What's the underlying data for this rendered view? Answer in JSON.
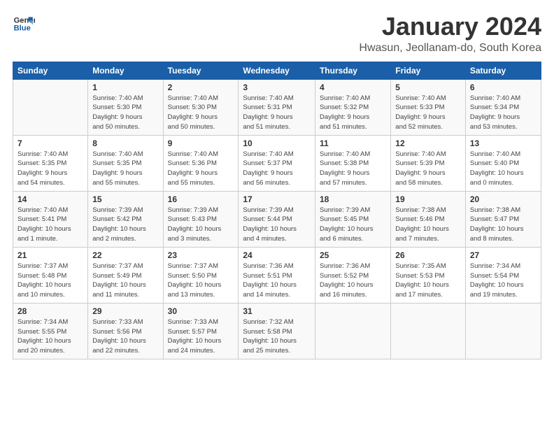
{
  "logo": {
    "line1": "General",
    "line2": "Blue"
  },
  "title": "January 2024",
  "subtitle": "Hwasun, Jeollanam-do, South Korea",
  "columns": [
    "Sunday",
    "Monday",
    "Tuesday",
    "Wednesday",
    "Thursday",
    "Friday",
    "Saturday"
  ],
  "weeks": [
    [
      {
        "day": "",
        "info": ""
      },
      {
        "day": "1",
        "info": "Sunrise: 7:40 AM\nSunset: 5:30 PM\nDaylight: 9 hours\nand 50 minutes."
      },
      {
        "day": "2",
        "info": "Sunrise: 7:40 AM\nSunset: 5:30 PM\nDaylight: 9 hours\nand 50 minutes."
      },
      {
        "day": "3",
        "info": "Sunrise: 7:40 AM\nSunset: 5:31 PM\nDaylight: 9 hours\nand 51 minutes."
      },
      {
        "day": "4",
        "info": "Sunrise: 7:40 AM\nSunset: 5:32 PM\nDaylight: 9 hours\nand 51 minutes."
      },
      {
        "day": "5",
        "info": "Sunrise: 7:40 AM\nSunset: 5:33 PM\nDaylight: 9 hours\nand 52 minutes."
      },
      {
        "day": "6",
        "info": "Sunrise: 7:40 AM\nSunset: 5:34 PM\nDaylight: 9 hours\nand 53 minutes."
      }
    ],
    [
      {
        "day": "7",
        "info": "Sunrise: 7:40 AM\nSunset: 5:35 PM\nDaylight: 9 hours\nand 54 minutes."
      },
      {
        "day": "8",
        "info": "Sunrise: 7:40 AM\nSunset: 5:35 PM\nDaylight: 9 hours\nand 55 minutes."
      },
      {
        "day": "9",
        "info": "Sunrise: 7:40 AM\nSunset: 5:36 PM\nDaylight: 9 hours\nand 55 minutes."
      },
      {
        "day": "10",
        "info": "Sunrise: 7:40 AM\nSunset: 5:37 PM\nDaylight: 9 hours\nand 56 minutes."
      },
      {
        "day": "11",
        "info": "Sunrise: 7:40 AM\nSunset: 5:38 PM\nDaylight: 9 hours\nand 57 minutes."
      },
      {
        "day": "12",
        "info": "Sunrise: 7:40 AM\nSunset: 5:39 PM\nDaylight: 9 hours\nand 58 minutes."
      },
      {
        "day": "13",
        "info": "Sunrise: 7:40 AM\nSunset: 5:40 PM\nDaylight: 10 hours\nand 0 minutes."
      }
    ],
    [
      {
        "day": "14",
        "info": "Sunrise: 7:40 AM\nSunset: 5:41 PM\nDaylight: 10 hours\nand 1 minute."
      },
      {
        "day": "15",
        "info": "Sunrise: 7:39 AM\nSunset: 5:42 PM\nDaylight: 10 hours\nand 2 minutes."
      },
      {
        "day": "16",
        "info": "Sunrise: 7:39 AM\nSunset: 5:43 PM\nDaylight: 10 hours\nand 3 minutes."
      },
      {
        "day": "17",
        "info": "Sunrise: 7:39 AM\nSunset: 5:44 PM\nDaylight: 10 hours\nand 4 minutes."
      },
      {
        "day": "18",
        "info": "Sunrise: 7:39 AM\nSunset: 5:45 PM\nDaylight: 10 hours\nand 6 minutes."
      },
      {
        "day": "19",
        "info": "Sunrise: 7:38 AM\nSunset: 5:46 PM\nDaylight: 10 hours\nand 7 minutes."
      },
      {
        "day": "20",
        "info": "Sunrise: 7:38 AM\nSunset: 5:47 PM\nDaylight: 10 hours\nand 8 minutes."
      }
    ],
    [
      {
        "day": "21",
        "info": "Sunrise: 7:37 AM\nSunset: 5:48 PM\nDaylight: 10 hours\nand 10 minutes."
      },
      {
        "day": "22",
        "info": "Sunrise: 7:37 AM\nSunset: 5:49 PM\nDaylight: 10 hours\nand 11 minutes."
      },
      {
        "day": "23",
        "info": "Sunrise: 7:37 AM\nSunset: 5:50 PM\nDaylight: 10 hours\nand 13 minutes."
      },
      {
        "day": "24",
        "info": "Sunrise: 7:36 AM\nSunset: 5:51 PM\nDaylight: 10 hours\nand 14 minutes."
      },
      {
        "day": "25",
        "info": "Sunrise: 7:36 AM\nSunset: 5:52 PM\nDaylight: 10 hours\nand 16 minutes."
      },
      {
        "day": "26",
        "info": "Sunrise: 7:35 AM\nSunset: 5:53 PM\nDaylight: 10 hours\nand 17 minutes."
      },
      {
        "day": "27",
        "info": "Sunrise: 7:34 AM\nSunset: 5:54 PM\nDaylight: 10 hours\nand 19 minutes."
      }
    ],
    [
      {
        "day": "28",
        "info": "Sunrise: 7:34 AM\nSunset: 5:55 PM\nDaylight: 10 hours\nand 20 minutes."
      },
      {
        "day": "29",
        "info": "Sunrise: 7:33 AM\nSunset: 5:56 PM\nDaylight: 10 hours\nand 22 minutes."
      },
      {
        "day": "30",
        "info": "Sunrise: 7:33 AM\nSunset: 5:57 PM\nDaylight: 10 hours\nand 24 minutes."
      },
      {
        "day": "31",
        "info": "Sunrise: 7:32 AM\nSunset: 5:58 PM\nDaylight: 10 hours\nand 25 minutes."
      },
      {
        "day": "",
        "info": ""
      },
      {
        "day": "",
        "info": ""
      },
      {
        "day": "",
        "info": ""
      }
    ]
  ]
}
